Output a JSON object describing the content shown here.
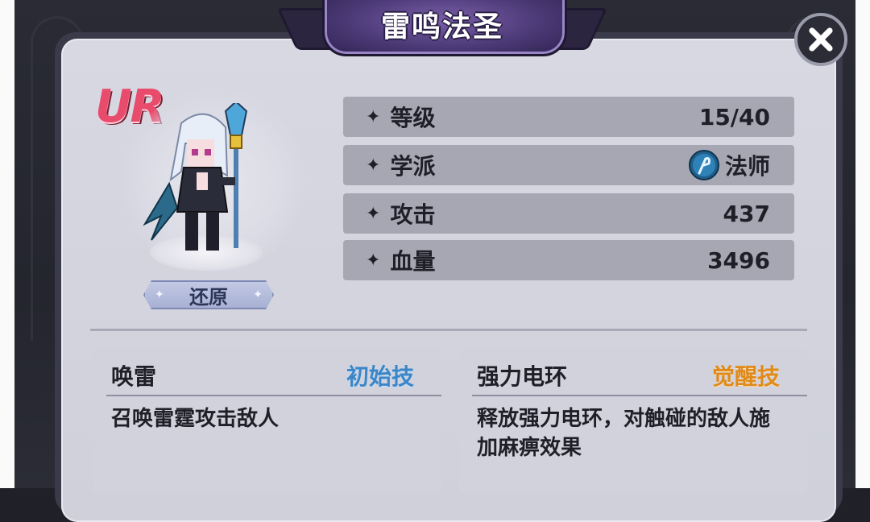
{
  "title": "雷鸣法圣",
  "rarity": "UR",
  "reset_label": "还原",
  "stats": [
    {
      "label": "等级",
      "value": "15/40"
    },
    {
      "label": "学派",
      "value": "法师",
      "icon": "mage-school-icon"
    },
    {
      "label": "攻击",
      "value": "437"
    },
    {
      "label": "血量",
      "value": "3496"
    }
  ],
  "bullet": "✦",
  "skills": [
    {
      "name": "唤雷",
      "tag": "初始技",
      "desc": "召唤雷霆攻击敌人"
    },
    {
      "name": "强力电环",
      "tag": "觉醒技",
      "desc": "释放强力电环，对触碰的敌人施加麻痹效果"
    }
  ],
  "colors": {
    "tag_initial": "#3a86c8",
    "tag_awaken": "#e08a1a",
    "rarity": "#e84b6b",
    "title_plate": "#4d3a78"
  }
}
